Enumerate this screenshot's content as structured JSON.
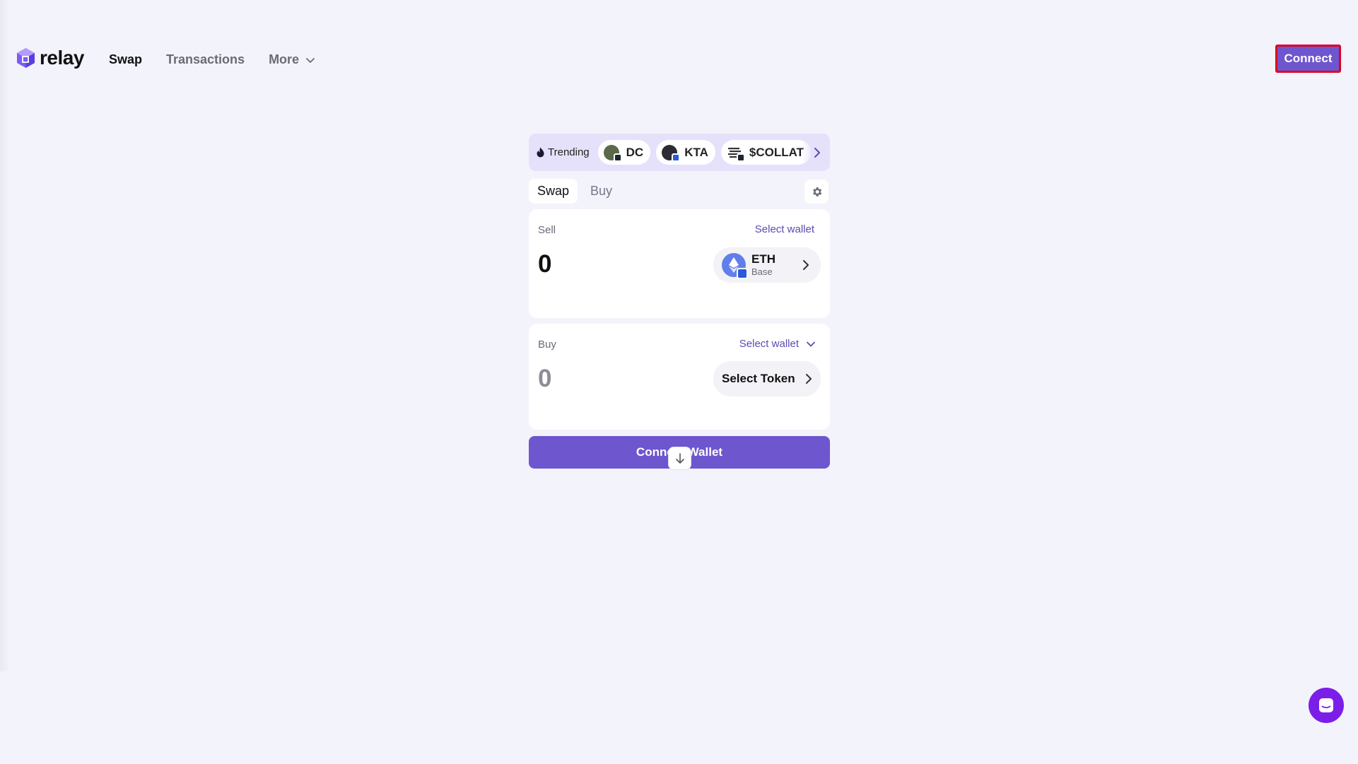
{
  "header": {
    "logo_text": "relay",
    "nav": [
      {
        "label": "Swap",
        "active": true
      },
      {
        "label": "Transactions",
        "active": false
      },
      {
        "label": "More",
        "active": false
      }
    ],
    "connect_label": "Connect"
  },
  "trending": {
    "label": "Trending",
    "tokens": [
      {
        "symbol": "DC",
        "icon": "dc-token-icon"
      },
      {
        "symbol": "KTA",
        "icon": "kta-token-icon"
      },
      {
        "symbol": "$COLLAT",
        "icon": "collat-token-icon"
      }
    ]
  },
  "tabs": {
    "swap": "Swap",
    "buy": "Buy"
  },
  "sell": {
    "label": "Sell",
    "select_wallet": "Select wallet",
    "amount": "0",
    "token_symbol": "ETH",
    "token_chain": "Base"
  },
  "buy": {
    "label": "Buy",
    "select_wallet": "Select wallet",
    "amount": "0",
    "select_token": "Select Token"
  },
  "cta_label": "Connect Wallet",
  "colors": {
    "accent": "#6e56cf",
    "background": "#f3f3fb",
    "trending_bg": "#e6e1fa",
    "chat": "#7b1fe8"
  }
}
